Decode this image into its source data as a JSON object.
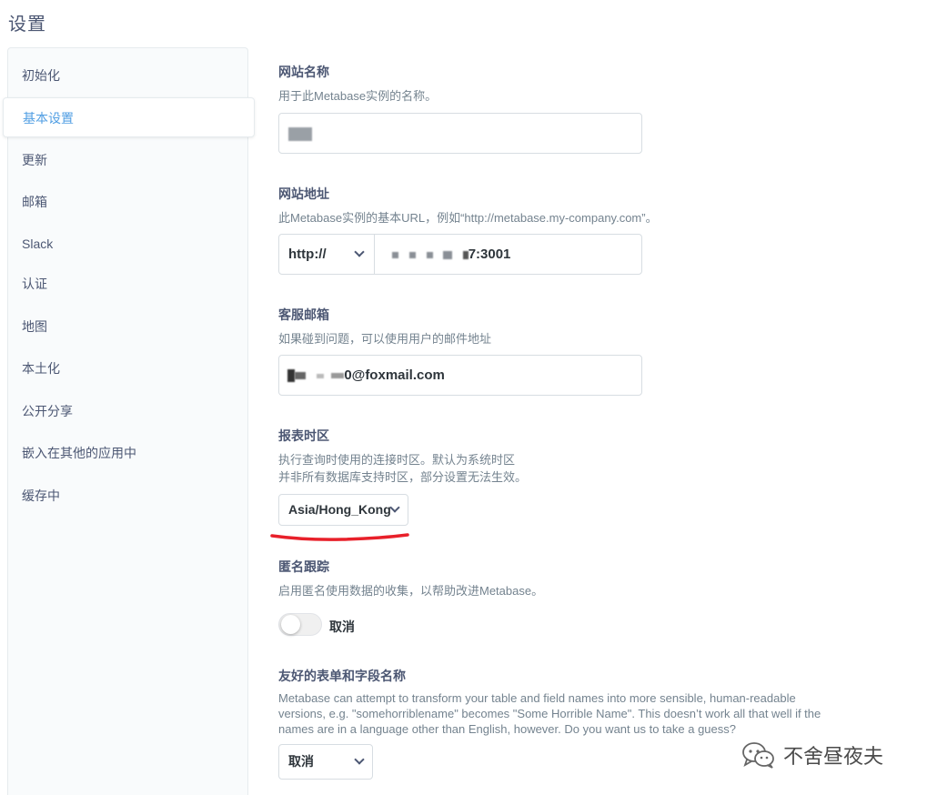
{
  "page": {
    "title": "设置"
  },
  "sidebar": {
    "items": [
      {
        "label": "初始化"
      },
      {
        "label": "基本设置"
      },
      {
        "label": "更新"
      },
      {
        "label": "邮箱"
      },
      {
        "label": "Slack"
      },
      {
        "label": "认证"
      },
      {
        "label": "地图"
      },
      {
        "label": "本土化"
      },
      {
        "label": "公开分享"
      },
      {
        "label": "嵌入在其他的应用中"
      },
      {
        "label": "缓存中"
      }
    ],
    "active_index": 1
  },
  "site_name": {
    "label": "网站名称",
    "description": "用于此Metabase实例的名称。"
  },
  "site_url": {
    "label": "网站地址",
    "description": "此Metabase实例的基本URL，例如“http://metabase.my-company.com”。",
    "protocol": "http://",
    "value_suffix": "7:3001"
  },
  "admin_email": {
    "label": "客服邮箱",
    "description": "如果碰到问题，可以使用用户的邮件地址",
    "value_suffix": "0@foxmail.com"
  },
  "timezone": {
    "label": "报表时区",
    "description_line1": "执行查询时使用的连接时区。默认为系统时区",
    "description_line2": "并非所有数据库支持时区，部分设置无法生效。",
    "value": "Asia/Hong_Kong"
  },
  "tracking": {
    "label": "匿名跟踪",
    "description": "启用匿名使用数据的收集，以帮助改进Metabase。",
    "toggle_label": "取消",
    "enabled": false
  },
  "friendly_names": {
    "label": "友好的表单和字段名称",
    "description": "Metabase can attempt to transform your table and field names into more sensible, human-readable versions, e.g. \"somehorriblename\" becomes \"Some Horrible Name\". This doesn’t work all that well if the names are in a language other than English, however. Do you want us to take a guess?",
    "value": "取消"
  },
  "watermark": {
    "text": "不舍昼夜夫",
    "icon": "wechat-icon"
  },
  "colors": {
    "accent": "#509ee3",
    "annotation": "#e8202a"
  }
}
